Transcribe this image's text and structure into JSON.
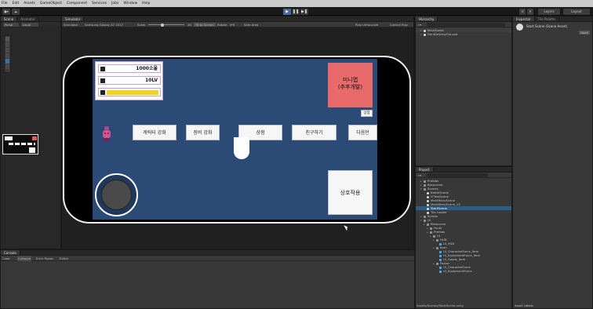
{
  "menu": [
    "File",
    "Edit",
    "Assets",
    "GameObject",
    "Component",
    "Services",
    "Jobs",
    "Window",
    "Help"
  ],
  "toolbar": {
    "account": "Layers",
    "layout": "Layout"
  },
  "scene_panel": {
    "tab_scene": "Scene",
    "tab_animator": "Animator",
    "persp": "Persp",
    "local": "Local"
  },
  "game_panel": {
    "tab": "Simulator",
    "simulator_label": "Simulator",
    "device": "Samsung Galaxy A7 2017",
    "scale_label": "Scale",
    "scale_value": "46",
    "fit_label": "Fit to Screen",
    "rotate_label": "Rotate",
    "safe_area": "Safe Area",
    "play_mode": "Play Unfocused",
    "control_label": "Control Play"
  },
  "game": {
    "gold": "1000소울",
    "level": "10LV",
    "minigame": "미니맵\n(추후개발)",
    "shop_small": "상점",
    "buttons": [
      "캐릭터 강화",
      "장비 강화",
      "상점",
      "친구하기",
      "다음던"
    ],
    "interact": "상호작용"
  },
  "hierarchy": {
    "tab": "Hierarchy",
    "items": [
      "MainScene",
      "DontDestroyOnLoad"
    ]
  },
  "inspector": {
    "tab": "Inspector",
    "tab2": "Tile Palette",
    "title": "Start Scene (Scene Asset)",
    "open": "Open"
  },
  "project": {
    "tab": "Project",
    "items": [
      {
        "label": "Prefabs",
        "type": "folder",
        "indent": 1
      },
      {
        "label": "Resources",
        "type": "folder",
        "indent": 1
      },
      {
        "label": "Scenes",
        "type": "folder",
        "indent": 1,
        "open": true
      },
      {
        "label": "BattleScene",
        "type": "scene",
        "indent": 2
      },
      {
        "label": "LTTestScene",
        "type": "scene",
        "indent": 2
      },
      {
        "label": "MainMenuScene",
        "type": "scene",
        "indent": 2
      },
      {
        "label": "MainMenuScene_V2",
        "type": "scene",
        "indent": 2
      },
      {
        "label": "StartScene",
        "type": "scene",
        "indent": 2,
        "selected": true
      },
      {
        "label": "Tile Loader",
        "type": "scene",
        "indent": 2
      },
      {
        "label": "Scripts",
        "type": "folder",
        "indent": 1
      },
      {
        "label": "UI",
        "type": "folder",
        "indent": 1,
        "open": true
      },
      {
        "label": "Resources",
        "type": "folder",
        "indent": 2
      },
      {
        "label": "Fonts",
        "type": "folder",
        "indent": 3
      },
      {
        "label": "Prefabs",
        "type": "folder",
        "indent": 3
      },
      {
        "label": "UI",
        "type": "folder",
        "indent": 4
      },
      {
        "label": "HUD",
        "type": "folder",
        "indent": 5
      },
      {
        "label": "UI_HUD",
        "type": "prefab",
        "indent": 6
      },
      {
        "label": "Item",
        "type": "folder",
        "indent": 5
      },
      {
        "label": "UI_CharacterForce_Item",
        "type": "prefab",
        "indent": 6
      },
      {
        "label": "UI_EquipmentForce_Item",
        "type": "prefab",
        "indent": 6
      },
      {
        "label": "UI_Goods_Item",
        "type": "prefab",
        "indent": 6
      },
      {
        "label": "Popup",
        "type": "folder",
        "indent": 5
      },
      {
        "label": "UI_CharacterForce",
        "type": "prefab",
        "indent": 6
      },
      {
        "label": "UI_EquipmentForce",
        "type": "prefab",
        "indent": 6
      }
    ],
    "footer": "Assets/Scenes/StartScene.unity",
    "asset_labels": "Asset Labels"
  },
  "console": {
    "tab": "Console",
    "clear": "Clear",
    "collapse": "Collapse",
    "error_pause": "Error Pause",
    "editor": "Editor"
  }
}
